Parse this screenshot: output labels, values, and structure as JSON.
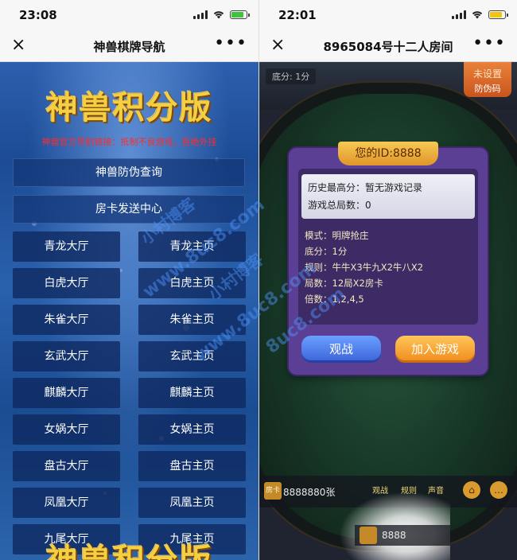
{
  "left": {
    "status": {
      "time": "23:08"
    },
    "titlebar": {
      "close": "×",
      "title": "神兽棋牌导航",
      "more": "•••"
    },
    "logo_text": "神兽积分版",
    "logo_text_bottom": "神兽积分版",
    "notice": "神兽官方导航链接：抵制不良游戏，拒绝外挂",
    "wide_buttons": [
      "神兽防伪查询",
      "房卡发送中心"
    ],
    "halls": [
      {
        "hall": "青龙大厅",
        "home": "青龙主页"
      },
      {
        "hall": "白虎大厅",
        "home": "白虎主页"
      },
      {
        "hall": "朱雀大厅",
        "home": "朱雀主页"
      },
      {
        "hall": "玄武大厅",
        "home": "玄武主页"
      },
      {
        "hall": "麒麟大厅",
        "home": "麒麟主页"
      },
      {
        "hall": "女娲大厅",
        "home": "女娲主页"
      },
      {
        "hall": "盘古大厅",
        "home": "盘古主页"
      },
      {
        "hall": "凤凰大厅",
        "home": "凤凰主页"
      },
      {
        "hall": "九尾大厅",
        "home": "九尾主页"
      }
    ]
  },
  "right": {
    "status": {
      "time": "22:01"
    },
    "titlebar": {
      "close": "×",
      "title": "8965084号十二人房间",
      "more": "•••"
    },
    "score_top": "底分: 1分",
    "tag": {
      "line1": "未设置",
      "line2": "防伪码"
    },
    "dialog": {
      "id_label": "您的ID:8888",
      "history_high": "历史最高分：暂无游戏记录",
      "total_rounds": "游戏总局数：0",
      "rules": [
        "模式：明牌抢庄",
        "底分：1分",
        "规则：牛牛X3牛九X2牛八X2",
        "局数：12局X2房卡",
        "倍数：1,2,4,5"
      ],
      "watch_button": "观战",
      "join_button": "加入游戏"
    },
    "bottombar": {
      "coin_icon": "房卡",
      "coins": "8888880张",
      "buttons": [
        "观战",
        "规则",
        "声音"
      ],
      "coins2": "8888"
    }
  },
  "watermarks": [
    "小村博客",
    "www.8uc8.com",
    "小村博客",
    "www.8uc8.com",
    "8uc8.com"
  ],
  "colors": {
    "notice_red": "#ff2b2b",
    "gold": "#f4cf42",
    "dialog_purple": "#5b3f94"
  }
}
